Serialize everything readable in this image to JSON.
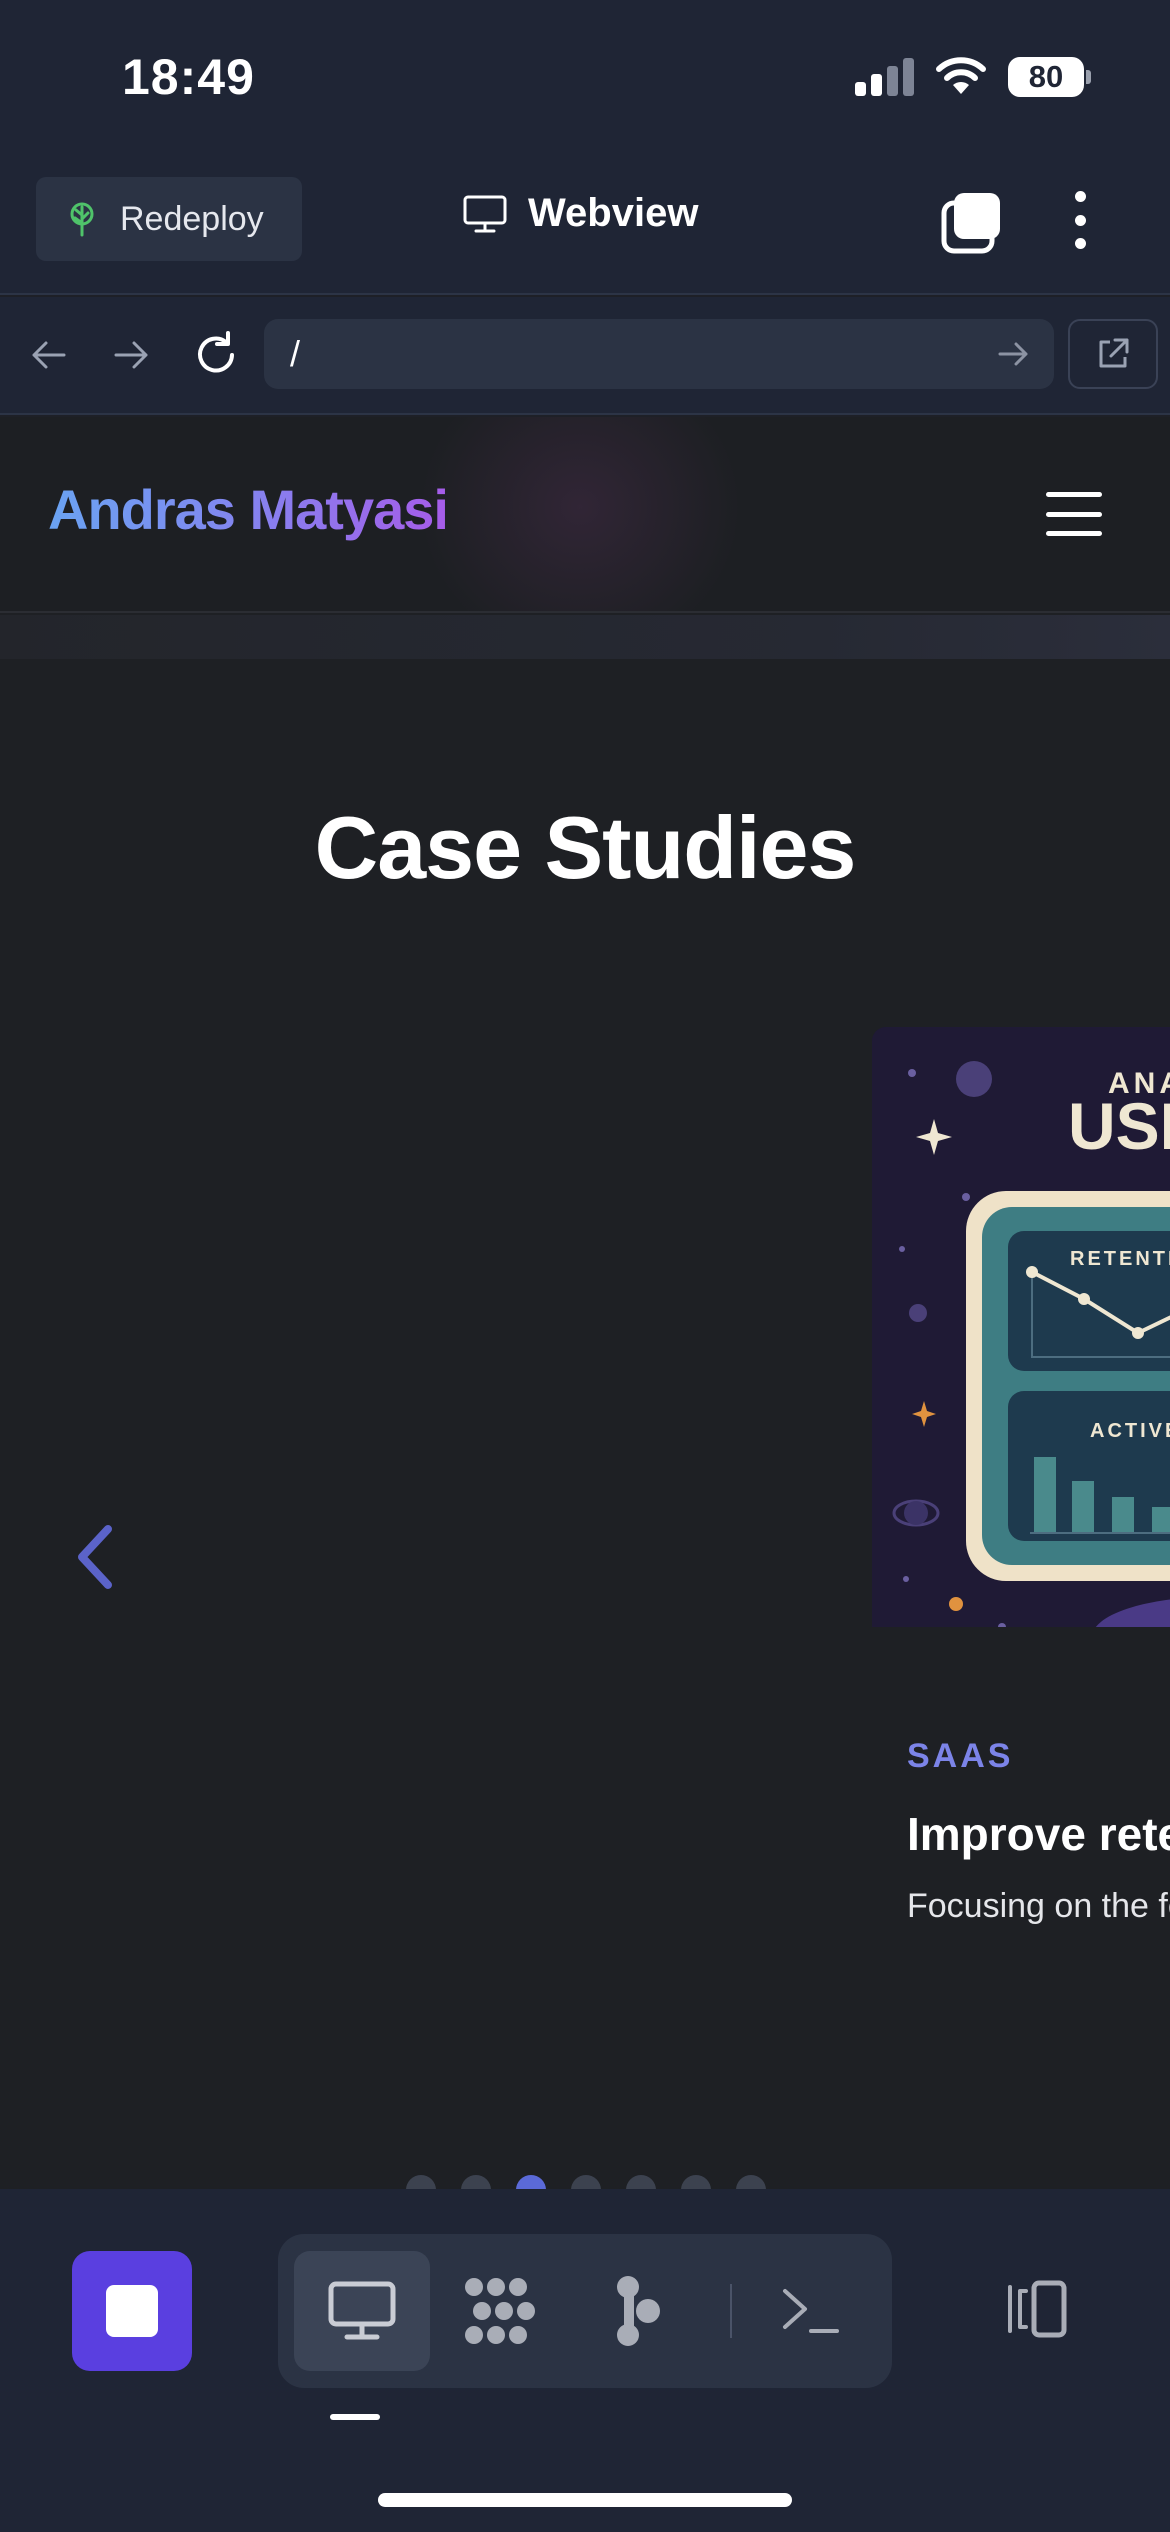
{
  "status_bar": {
    "time": "18:49",
    "battery": "80"
  },
  "app_bar": {
    "redeploy_label": "Redeploy",
    "title": "Webview"
  },
  "url_bar": {
    "value": "/"
  },
  "site": {
    "brand": "Andras Matyasi",
    "section_title": "Case Studies",
    "card": {
      "tag": "SAAS",
      "title": "Improve rete",
      "description": "Focusing on the features",
      "art": {
        "eyebrow": "ANA",
        "headline": "USI",
        "panel_top_label": "RETENTIO",
        "panel_bottom_label": "ACTIVE"
      }
    },
    "carousel": {
      "dot_count": 7,
      "active_index": 2
    }
  },
  "colors": {
    "accent": "#5a3fe0",
    "tag": "#7c84e8",
    "dot_active": "#5b6ad8"
  },
  "icons": [
    "signal-icon",
    "wifi-icon",
    "battery-icon",
    "tree-icon",
    "monitor-icon",
    "tabs-icon",
    "more-icon",
    "back-icon",
    "forward-icon",
    "reload-icon",
    "go-icon",
    "external-link-icon",
    "menu-icon",
    "chevron-left-icon",
    "stop-icon",
    "dots-grid-icon",
    "graph-icon",
    "terminal-icon",
    "side-panel-icon"
  ]
}
